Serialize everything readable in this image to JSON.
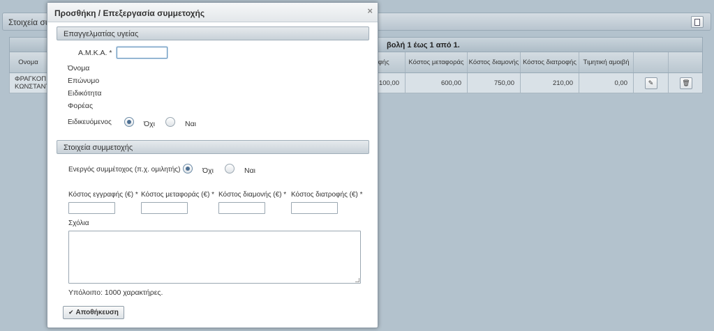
{
  "background": {
    "panel_title": "Στοιχεία συμ",
    "pager_text": "βολή 1 έως 1 από 1.",
    "columns": [
      {
        "label": "Ονομα"
      },
      {
        "label": "ηφής"
      },
      {
        "label": "Κόστος μεταφοράς"
      },
      {
        "label": "Κόστος διαμονής"
      },
      {
        "label": "Κόστος διατροφής"
      },
      {
        "label": "Τιμητική αμοιβή"
      }
    ],
    "row": {
      "name": "ΦΡΑΓΚΟΠ\nΚΩΝΣΤΑΝΤ",
      "registration_cost": "100,00",
      "transport_cost": "600,00",
      "accommodation_cost": "750,00",
      "food_cost": "210,00",
      "honorarium": "0,00"
    },
    "icons": {
      "export": "document-icon",
      "edit": "pencil-icon",
      "delete": "trash-icon"
    }
  },
  "modal": {
    "title": "Προσθήκη / Επεξεργασία συμμετοχής",
    "close_glyph": "×",
    "section_health": {
      "header": "Επαγγελματίας υγείας",
      "amka_label": "Α.Μ.Κ.Α. *",
      "amka_value": "",
      "name_label": "Όνομα",
      "surname_label": "Επώνυμο",
      "specialty_label": "Ειδικότητα",
      "organization_label": "Φορέας",
      "resident_label": "Ειδικευόμενος",
      "option_no": "Όχι",
      "option_yes": "Ναι",
      "resident_selected": "Όχι"
    },
    "section_participation": {
      "header": "Στοιχεία συμμετοχής",
      "active_label": "Ενεργός συμμέτοχος (π.χ. ομιλητής)",
      "option_no": "Όχι",
      "option_yes": "Ναι",
      "active_selected": "Όχι",
      "reg_cost_label": "Κόστος εγγραφής (€) *",
      "transport_cost_label": "Κόστος μεταφοράς (€) *",
      "accommodation_cost_label": "Κόστος διαμονής (€) *",
      "food_cost_label": "Κόστος διατροφής (€) *",
      "comments_label": "Σχόλια",
      "remaining_text": "Υπόλοιπο: 1000 χαρακτήρες."
    },
    "save_label": "Αποθήκευση"
  }
}
